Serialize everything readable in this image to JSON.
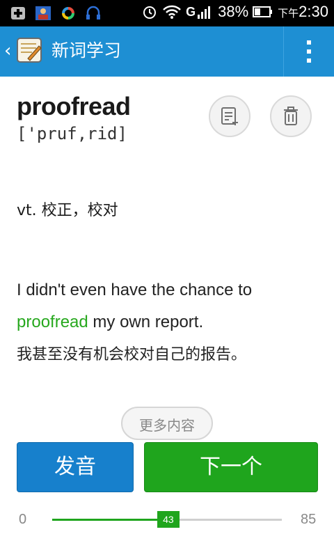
{
  "status_bar": {
    "network_tag": "G",
    "battery_percent": "38%",
    "time_prefix": "下午",
    "time": "2:30",
    "icons": [
      "add-icon",
      "contacts-app-icon",
      "sync-app-icon",
      "headset-icon",
      "alarm-icon",
      "wifi-icon",
      "signal-icon",
      "battery-icon"
    ]
  },
  "app_bar": {
    "title": "新词学习",
    "icons": [
      "back-chevron-icon",
      "notebook-app-icon",
      "overflow-menu-icon"
    ]
  },
  "word": {
    "headword": "proofread",
    "phonetic": "['pruf,rid]",
    "definition": "vt. 校正，校对",
    "example_before": "I didn't even have the chance to ",
    "example_highlight": "proofread",
    "example_after": " my own report.",
    "example_translation": "我甚至没有机会校对自己的报告。",
    "actions": [
      "add-to-notebook-icon",
      "trash-icon"
    ]
  },
  "more_button": "更多内容",
  "buttons": {
    "pronounce": "发音",
    "next": "下一个"
  },
  "progress": {
    "min": "0",
    "max": "85",
    "current": "43",
    "value": 43,
    "max_value": 85
  },
  "colors": {
    "app_bar": "#1e8fd3",
    "accent_green": "#1fa51d",
    "primary_blue": "#1780cc",
    "highlight": "#27a81e"
  }
}
